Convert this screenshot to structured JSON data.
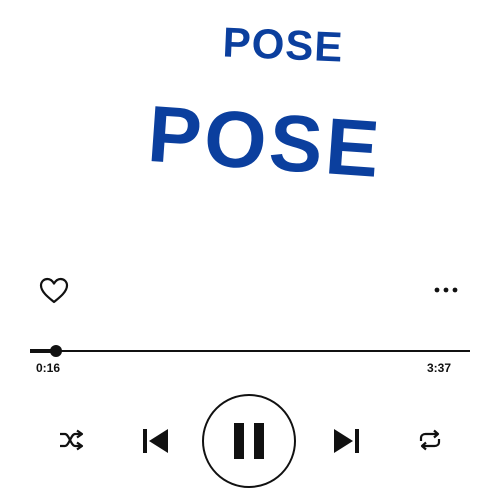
{
  "song": {
    "title_small": "POSE",
    "title_large": "POSE"
  },
  "player": {
    "elapsed": "0:16",
    "duration": "3:37",
    "progress_fraction": 0.06,
    "state": "playing",
    "liked": false
  },
  "colors": {
    "title": "#0b3f9e",
    "controls": "#111111",
    "background": "#ffffff"
  },
  "icons": {
    "like": "heart-outline-icon",
    "more": "more-horizontal-icon",
    "shuffle": "shuffle-icon",
    "previous": "skip-previous-icon",
    "play_pause": "pause-icon",
    "next": "skip-next-icon",
    "repeat": "repeat-icon"
  }
}
